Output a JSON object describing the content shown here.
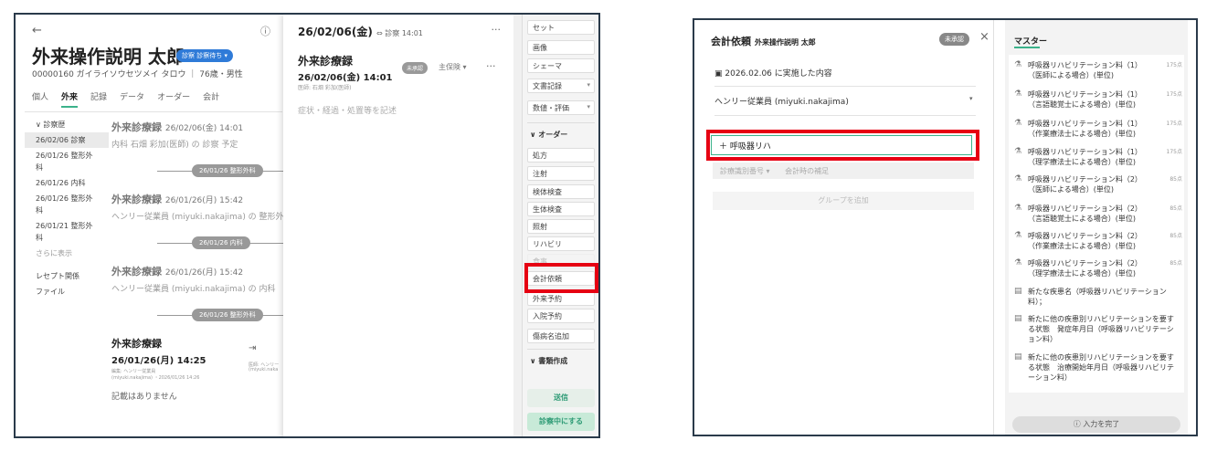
{
  "left": {
    "back_icon": "back-arrow-icon",
    "title": "外来操作説明 太郎",
    "status_badge": "診察 診察待ち ▾",
    "patient_id": "00000160 ガイライソウセツメイ タロウ ｜ 76歳・男性",
    "tabs": [
      "個人",
      "外来",
      "記録",
      "データ",
      "オーダー",
      "会計"
    ],
    "nav": {
      "group": "∨ 診察歴",
      "items": [
        "26/02/06 診察",
        "26/01/26 整形外科",
        "26/01/26 内科",
        "26/01/26 整形外科",
        "26/01/21 整形外科"
      ],
      "more": "さらに表示",
      "receipt": "レセプト関係",
      "file": "ファイル"
    },
    "records": [
      {
        "title": "外来診療録",
        "date": "26/02/06(金) 14:01",
        "sub": "内科 石畑 彩加(医師) の 診察 予定"
      },
      {
        "separator": "26/01/26 整形外科"
      },
      {
        "title": "外来診療録",
        "date": "26/01/26(月) 15:42",
        "sub": "ヘンリー従業員 (miyuki.nakajima) の 整形外"
      },
      {
        "separator": "26/01/26 内科"
      },
      {
        "title": "外来診療録",
        "date": "26/01/26(月) 15:42",
        "sub": "ヘンリー従業員 (miyuki.nakajima) の 内科"
      },
      {
        "separator": "26/01/26 整形外科"
      }
    ],
    "bottom_record": {
      "title": "外来診療録",
      "date": "26/01/26(月) 14:25",
      "edit1": "編集: ヘンリー従業員",
      "edit2": "(miyuki.nakajima) ・2026/01/26 14:26",
      "doc1": "医師: ヘンリー",
      "doc2": "(miyuki.naka",
      "empty": "記載はありません"
    },
    "dialog": {
      "header_date": "26/02/06(金)",
      "header_link": "⇔ 診察 14:01",
      "title": "外来診療録",
      "date": "26/02/06(金) 14:01",
      "doctor": "医師: 石畑 彩加(医師)",
      "badge": "未承認",
      "insurance": "主保険 ▾",
      "placeholder": "症状・経過・処置等を記述"
    },
    "side": {
      "set": "セット",
      "image": "画像",
      "schema": "シェーマ",
      "doc_record": "文書記録",
      "numeric": "数値・評価",
      "order_group": "∨ オーダー",
      "orders": [
        "処方",
        "注射",
        "検体検査",
        "生体検査",
        "照射",
        "リハビリ"
      ],
      "meal": "食事",
      "billing": "会計依頼",
      "outpatient_res": "外来予約",
      "inpatient_res": "入院予約",
      "disease_add": "傷病名追加",
      "doc_group": "∨ 書類作成",
      "send": "送信",
      "in_exam": "診察中にする"
    }
  },
  "right": {
    "title": "会計依頼",
    "patient": "外来操作説明 太郎",
    "badge": "未承認",
    "close": "×",
    "date_line": "2026.02.06 に実施した内容",
    "user": "ヘンリー従業員 (miyuki.nakajima)",
    "input_value": "＋  呼吸器リハ",
    "item_label": "診療識別番号 ▾",
    "item_note": "会計時の補足",
    "add_group": "グループを追加",
    "master_tab": "マスター",
    "master_items": [
      {
        "icon": "pill-icon",
        "text": "呼吸器リハビリテーション料（1）（医師による場合）(単位)",
        "pts": "175点"
      },
      {
        "icon": "pill-icon",
        "text": "呼吸器リハビリテーション料（1）（言語聴覚士による場合）(単位)",
        "pts": "175点"
      },
      {
        "icon": "pill-icon",
        "text": "呼吸器リハビリテーション料（1）（作業療法士による場合）(単位)",
        "pts": "175点"
      },
      {
        "icon": "pill-icon",
        "text": "呼吸器リハビリテーション料（1）（理学療法士による場合）(単位)",
        "pts": "175点"
      },
      {
        "icon": "pill-icon",
        "text": "呼吸器リハビリテーション料（2）（医師による場合）(単位)",
        "pts": "85点"
      },
      {
        "icon": "pill-icon",
        "text": "呼吸器リハビリテーション料（2）（言語聴覚士による場合）(単位)",
        "pts": "85点"
      },
      {
        "icon": "pill-icon",
        "text": "呼吸器リハビリテーション料（2）（作業療法士による場合）(単位)",
        "pts": "85点"
      },
      {
        "icon": "pill-icon",
        "text": "呼吸器リハビリテーション料（2）（理学療法士による場合）(単位)",
        "pts": "85点"
      },
      {
        "icon": "comment-icon",
        "text": "新たな疾患名（呼吸器リハビリテーション料）；",
        "pts": ""
      },
      {
        "icon": "comment-icon",
        "text": "新たに他の疾患別リハビリテーションを要する状態　発症年月日（呼吸器リハビリテーション料）",
        "pts": ""
      },
      {
        "icon": "comment-icon",
        "text": "新たに他の疾患別リハビリテーションを要する状態　治療開始年月日（呼吸器リハビリテーション料）",
        "pts": ""
      }
    ],
    "complete": "ⓘ 入力を完了"
  },
  "colors": {
    "accent": "#3bb28a",
    "highlight": "#e60012",
    "badge_blue": "#2f7bd8"
  }
}
